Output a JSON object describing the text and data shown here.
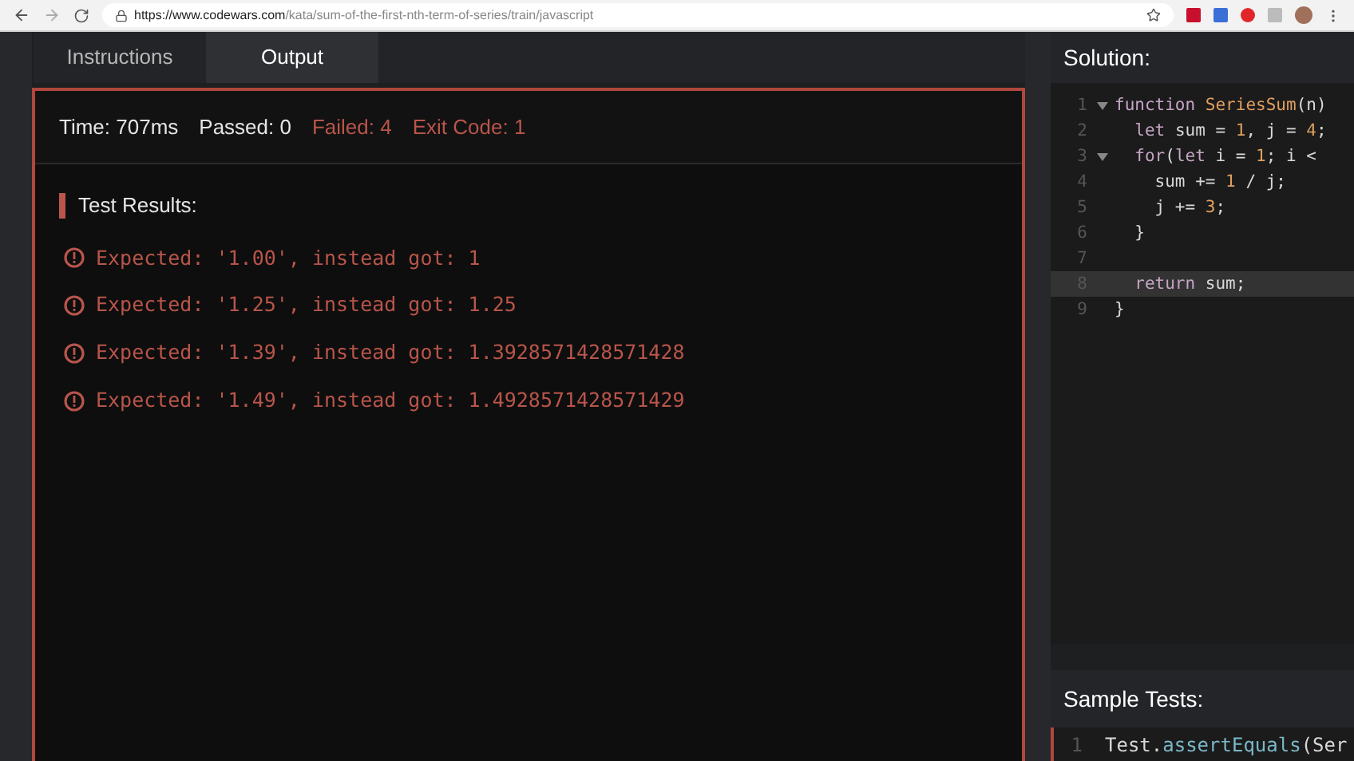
{
  "browser": {
    "url_host": "https://www.codewars.com",
    "url_path": "/kata/sum-of-the-first-nth-term-of-series/train/javascript"
  },
  "tabs": [
    {
      "label": "Instructions",
      "selected": false
    },
    {
      "label": "Output",
      "selected": true
    }
  ],
  "output": {
    "stats": [
      {
        "text": "Time: 707ms",
        "failed": false
      },
      {
        "text": "Passed: 0",
        "failed": false
      },
      {
        "text": "Failed: 4",
        "failed": true
      },
      {
        "text": "Exit Code: 1",
        "failed": true
      }
    ],
    "results_title": "Test Results:",
    "results": [
      "Expected: '1.00', instead got: 1",
      "Expected: '1.25', instead got: 1.25",
      "Expected: '1.39', instead got: 1.3928571428571428",
      "Expected: '1.49', instead got: 1.4928571428571429"
    ]
  },
  "solution": {
    "title": "Solution:",
    "lines": [
      {
        "number": "1",
        "foldable": true,
        "active": false,
        "tokens": [
          {
            "kind": "keyword",
            "text": "function "
          },
          {
            "kind": "name",
            "text": "SeriesSum"
          },
          {
            "kind": "plain",
            "text": "(n)"
          }
        ]
      },
      {
        "number": "2",
        "foldable": false,
        "active": false,
        "tokens": [
          {
            "kind": "keyword",
            "text": "  let "
          },
          {
            "kind": "plain",
            "text": "sum = "
          },
          {
            "kind": "num",
            "text": "1"
          },
          {
            "kind": "plain",
            "text": ", j = "
          },
          {
            "kind": "num",
            "text": "4"
          },
          {
            "kind": "plain",
            "text": ";"
          }
        ]
      },
      {
        "number": "3",
        "foldable": true,
        "active": false,
        "tokens": [
          {
            "kind": "keyword",
            "text": "  for"
          },
          {
            "kind": "plain",
            "text": "("
          },
          {
            "kind": "keyword",
            "text": "let "
          },
          {
            "kind": "plain",
            "text": "i = "
          },
          {
            "kind": "num",
            "text": "1"
          },
          {
            "kind": "plain",
            "text": "; i <"
          }
        ]
      },
      {
        "number": "4",
        "foldable": false,
        "active": false,
        "tokens": [
          {
            "kind": "plain",
            "text": "    sum += "
          },
          {
            "kind": "num",
            "text": "1"
          },
          {
            "kind": "plain",
            "text": " / j;"
          }
        ]
      },
      {
        "number": "5",
        "foldable": false,
        "active": false,
        "tokens": [
          {
            "kind": "plain",
            "text": "    j += "
          },
          {
            "kind": "num",
            "text": "3"
          },
          {
            "kind": "plain",
            "text": ";"
          }
        ]
      },
      {
        "number": "6",
        "foldable": false,
        "active": false,
        "tokens": [
          {
            "kind": "plain",
            "text": "  }"
          }
        ]
      },
      {
        "number": "7",
        "foldable": false,
        "active": false
      },
      {
        "number": "8",
        "foldable": false,
        "active": true,
        "tokens": [
          {
            "kind": "keyword",
            "text": "  return "
          },
          {
            "kind": "plain",
            "text": "sum;"
          }
        ]
      },
      {
        "number": "9",
        "foldable": false,
        "active": false,
        "tokens": [
          {
            "kind": "plain",
            "text": "}"
          }
        ]
      }
    ]
  },
  "sample_tests": {
    "title": "Sample Tests:",
    "lines": [
      {
        "number": "1",
        "tokens": [
          {
            "kind": "plain",
            "text": "Test."
          },
          {
            "kind": "method",
            "text": "assertEquals"
          },
          {
            "kind": "plain",
            "text": "(Ser"
          }
        ]
      }
    ]
  }
}
